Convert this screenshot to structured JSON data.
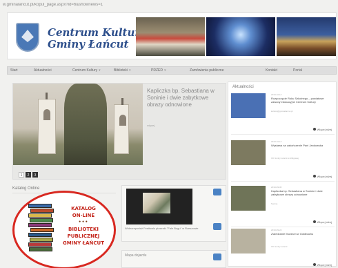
{
  "browser": {
    "url": "w.gminalancut.pl/kopul_page.aspx?id=6&shownews=1"
  },
  "header": {
    "logo_line1": "Centrum Kultury",
    "logo_line2": "Gminy Łańcut"
  },
  "nav": {
    "items": [
      "Start",
      "Aktualności",
      "Centrum Kultury",
      "Biblioteki",
      "PRZED",
      "Zamówienia publiczne",
      "Kontakt",
      "Portal"
    ],
    "dropdown_indicator": "▾"
  },
  "slider": {
    "title": "Kapliczka bp. Sebastiana w Soninie i dwie zabytkowe obrazy odnowione",
    "more_label": "więcej",
    "pages": [
      "1",
      "2",
      "3"
    ],
    "active_page": 2
  },
  "katalog": {
    "heading": "Katalog Online",
    "line1": "KATALOG",
    "line2": "ON-LINE",
    "dots": "•••",
    "line3": "BIBLIOTEKI",
    "line4": "PUBLICZNEJ",
    "line5": "GMINY ŁAŃCUT"
  },
  "video": {
    "caption": "Wideoreportaż Festiwalu piosenki \"Fale Bugu\" w Rzeszowie"
  },
  "mapa": {
    "title": "Mapa dojazdu"
  },
  "aktualnosci": {
    "heading": "Aktualności",
    "more_label": "Więcej niżej",
    "items": [
      {
        "date": "2013-10-14",
        "title": "Rozpoczęcie Roku Szkolnego – powiatowe zawody edukacyjne Centrum Kultury",
        "meta": "kultura@gminalancut.pl",
        "thumb_color": "#4a70b4"
      },
      {
        "date": "2013-10-12",
        "title": "Wystawa na zakończenie Pani Jankowska",
        "meta": "CK Gminy Łańcut w Albigowej",
        "thumb_color": "#7d7a60"
      },
      {
        "date": "2013-09-30",
        "title": "Kapliczka bp. Sebastiana w Soninie i dwie zabytkowe obrazy odnowione",
        "meta": "Sonina",
        "thumb_color": "#6f7458"
      },
      {
        "date": "2013-09-24",
        "title": "Zwiedzanie Muzeum w Gołdbachu",
        "meta": "CK Gminy Łańcut",
        "thumb_color": "#b8b2a0"
      }
    ]
  },
  "colors": {
    "brand_blue": "#2d4f8c",
    "katalog_red": "#d82820",
    "icon_blue": "#4a82c4"
  }
}
